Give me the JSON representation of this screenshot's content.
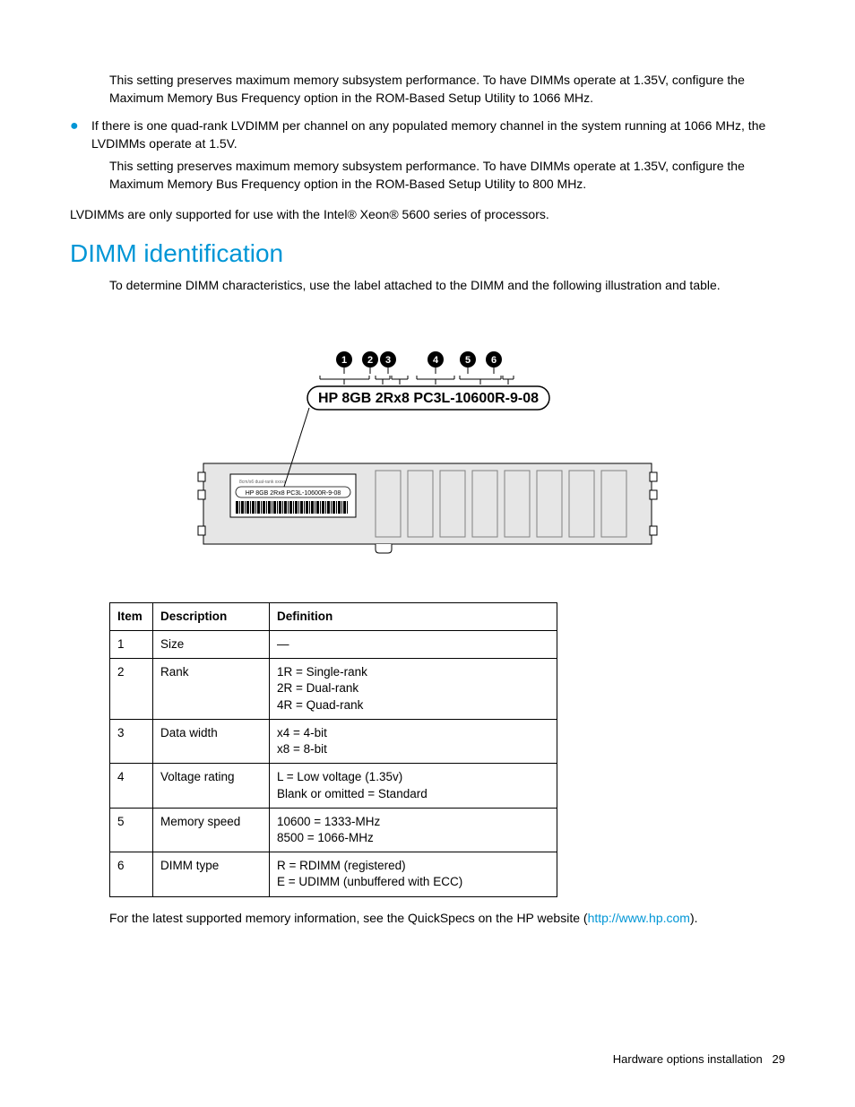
{
  "para1": "This setting preserves maximum memory subsystem performance. To have DIMMs operate at 1.35V, configure the Maximum Memory Bus Frequency option in the ROM-Based Setup Utility to 1066 MHz.",
  "bullet1": "If there is one quad-rank LVDIMM per channel on any populated memory channel in the system running at 1066 MHz, the LVDIMMs operate at 1.5V.",
  "para2": "This setting preserves maximum memory subsystem performance. To have DIMMs operate at 1.35V, configure the Maximum Memory Bus Frequency option in the ROM-Based Setup Utility to 800 MHz.",
  "para3": "LVDIMMs are only supported for use with the Intel® Xeon® 5600 series of processors.",
  "heading": "DIMM identification",
  "intro": "To determine DIMM characteristics, use the label attached to the DIMM and the following illustration and table.",
  "diagram": {
    "callouts": [
      "1",
      "2",
      "3",
      "4",
      "5",
      "6"
    ],
    "label_text": "HP 8GB 2Rx8 PC3L-10600R-9-08",
    "small_label": "HP 8GB 2Rx8 PC3L-10600R-9-08"
  },
  "table": {
    "headers": [
      "Item",
      "Description",
      "Definition"
    ],
    "rows": [
      {
        "item": "1",
        "desc": "Size",
        "def": "—"
      },
      {
        "item": "2",
        "desc": "Rank",
        "def": "1R = Single-rank\n2R = Dual-rank\n4R = Quad-rank"
      },
      {
        "item": "3",
        "desc": "Data width",
        "def": "x4 = 4-bit\nx8 = 8-bit"
      },
      {
        "item": "4",
        "desc": "Voltage rating",
        "def": "L = Low voltage (1.35v)\nBlank or omitted = Standard"
      },
      {
        "item": "5",
        "desc": "Memory speed",
        "def": "10600 = 1333-MHz\n8500 = 1066-MHz"
      },
      {
        "item": "6",
        "desc": "DIMM type",
        "def": "R = RDIMM (registered)\nE = UDIMM (unbuffered with ECC)"
      }
    ]
  },
  "closing_pre": "For the latest supported memory information, see the QuickSpecs on the HP website (",
  "closing_link": "http://www.hp.com",
  "closing_post": ").",
  "footer_section": "Hardware options installation",
  "footer_page": "29"
}
